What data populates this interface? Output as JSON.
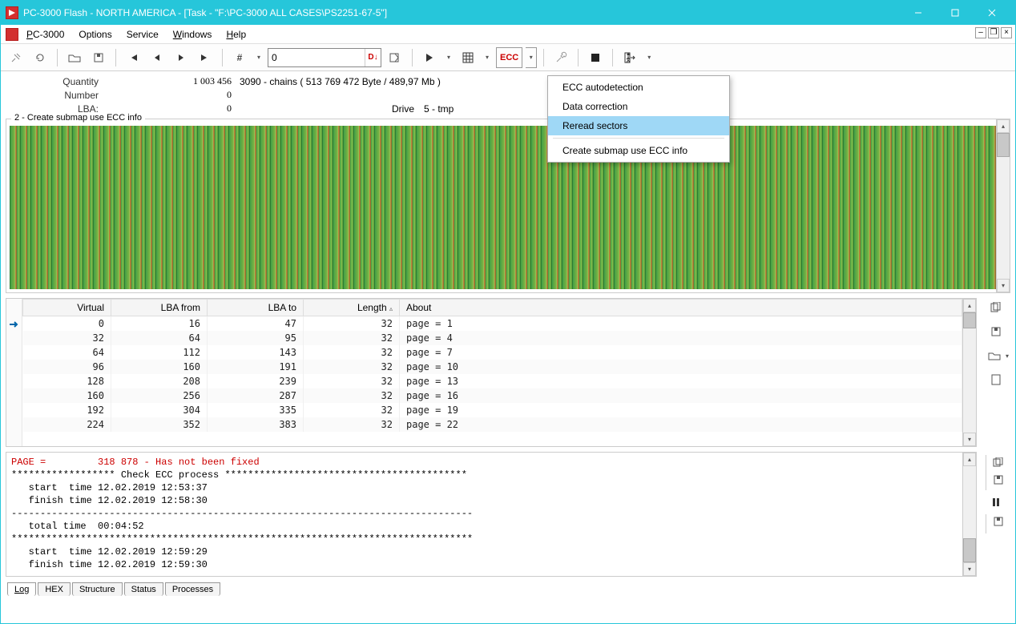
{
  "window_title": "PC-3000 Flash - NORTH AMERICA - [Task - \"F:\\PC-3000 ALL CASES\\PS2251-67-5\"]",
  "menus": {
    "pc3000": "PC-3000",
    "options": "Options",
    "service": "Service",
    "windows": "Windows",
    "help": "Help"
  },
  "toolbar": {
    "jump_value": "0",
    "ecc_label": "ECC"
  },
  "info": {
    "quantity_label": "Quantity",
    "quantity_value": "1 003 456",
    "quantity_extra": "3090 - chains  ( 513 769 472 Byte /  489,97 Mb )",
    "number_label": "Number",
    "number_value": "0",
    "lba_label": "LBA:",
    "lba_value": "0",
    "drive_label": "Drive",
    "drive_value": "5 - tmp"
  },
  "group_legend": "2 - Create submap use ECC info",
  "table": {
    "headers": {
      "virtual": "Virtual",
      "lba_from": "LBA from",
      "lba_to": "LBA to",
      "length": "Length",
      "about": "About"
    },
    "rows": [
      {
        "virtual": "0",
        "from": "16",
        "to": "47",
        "len": "32",
        "about": "page = 1"
      },
      {
        "virtual": "32",
        "from": "64",
        "to": "95",
        "len": "32",
        "about": "page = 4"
      },
      {
        "virtual": "64",
        "from": "112",
        "to": "143",
        "len": "32",
        "about": "page = 7"
      },
      {
        "virtual": "96",
        "from": "160",
        "to": "191",
        "len": "32",
        "about": "page = 10"
      },
      {
        "virtual": "128",
        "from": "208",
        "to": "239",
        "len": "32",
        "about": "page = 13"
      },
      {
        "virtual": "160",
        "from": "256",
        "to": "287",
        "len": "32",
        "about": "page = 16"
      },
      {
        "virtual": "192",
        "from": "304",
        "to": "335",
        "len": "32",
        "about": "page = 19"
      },
      {
        "virtual": "224",
        "from": "352",
        "to": "383",
        "len": "32",
        "about": "page = 22"
      }
    ]
  },
  "log": {
    "l1a": "PAGE =",
    "l1b": "         318 878 - Has not been fixed",
    "l2": "****************** Check ECC process ******************************************",
    "l3": "   start  time 12.02.2019 12:53:37",
    "l4": "   finish time 12.02.2019 12:58:30",
    "l5": "--------------------------------------------------------------------------------",
    "l6": "   total time  00:04:52",
    "l7": "********************************************************************************",
    "l8": "   start  time 12.02.2019 12:59:29",
    "l9": "   finish time 12.02.2019 12:59:30"
  },
  "tabs": {
    "log": "Log",
    "hex": "HEX",
    "structure": "Structure",
    "status": "Status",
    "processes": "Processes"
  },
  "dropdown": {
    "i1": "ECC autodetection",
    "i2": "Data correction",
    "i3": "Reread sectors",
    "i4": "Create submap use ECC info"
  }
}
